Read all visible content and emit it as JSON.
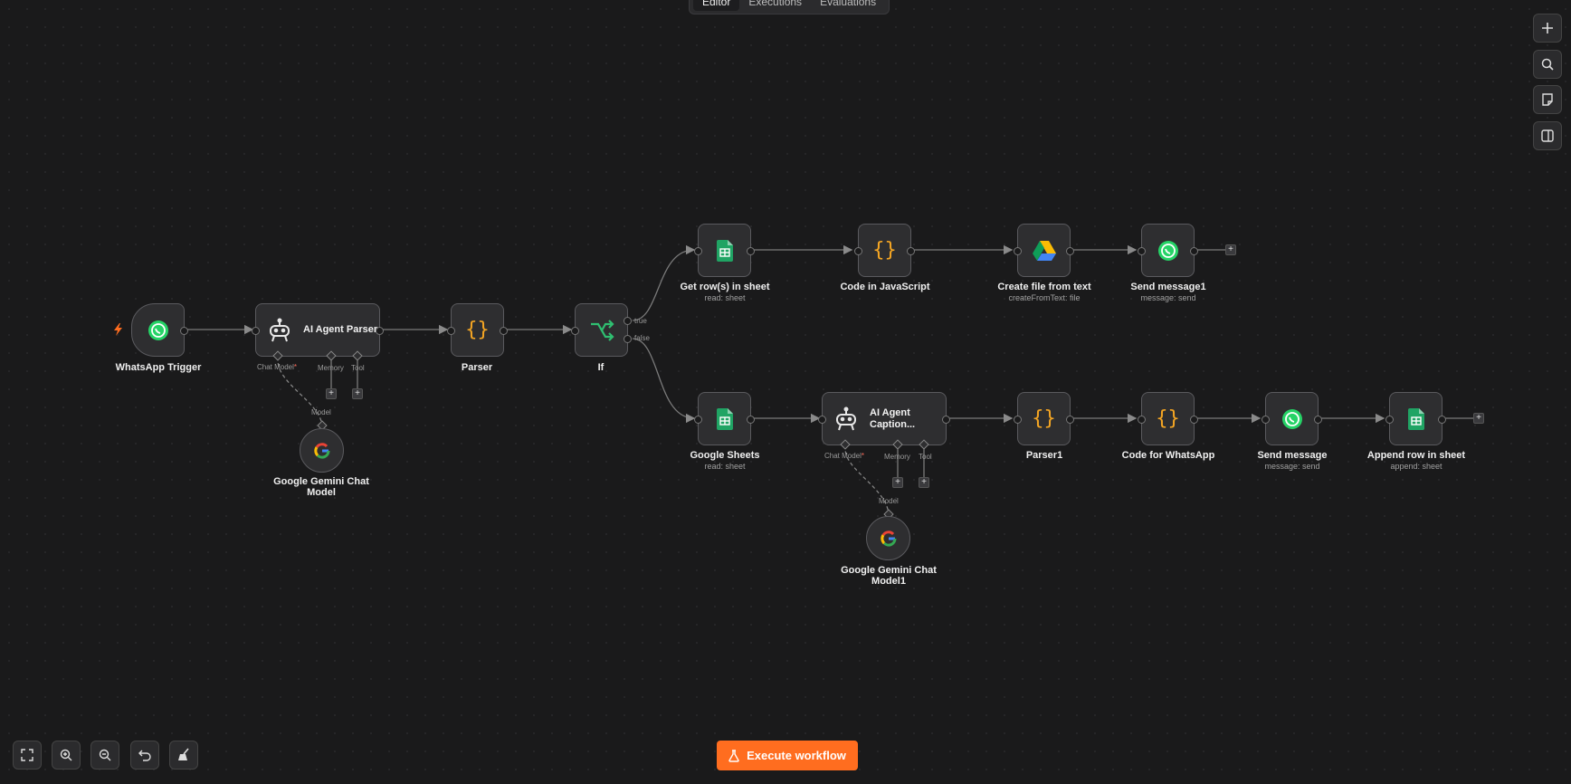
{
  "tabs": [
    "Editor",
    "Executions",
    "Evaluations"
  ],
  "nodes": {
    "whatsapp_trigger": {
      "label": "WhatsApp Trigger"
    },
    "ai_agent_parser": {
      "title": "AI Agent Parser",
      "ports": {
        "chat_model": "Chat Model",
        "memory": "Memory",
        "tool": "Tool"
      }
    },
    "gemini_1": {
      "label": "Google Gemini Chat Model",
      "port": "Model"
    },
    "parser": {
      "label": "Parser"
    },
    "if": {
      "label": "If",
      "true_label": "true",
      "false_label": "false"
    },
    "get_rows": {
      "label": "Get row(s) in sheet",
      "sub": "read: sheet"
    },
    "code_js": {
      "label": "Code in JavaScript"
    },
    "create_file": {
      "label": "Create file from text",
      "sub": "createFromText: file"
    },
    "send_message1": {
      "label": "Send message1",
      "sub": "message: send"
    },
    "google_sheets": {
      "label": "Google Sheets",
      "sub": "read: sheet"
    },
    "ai_agent_caption": {
      "title": "AI Agent Caption...",
      "ports": {
        "chat_model": "Chat Model",
        "memory": "Memory",
        "tool": "Tool"
      }
    },
    "gemini_2": {
      "label": "Google Gemini Chat Model1",
      "port": "Model"
    },
    "parser1": {
      "label": "Parser1"
    },
    "code_whatsapp": {
      "label": "Code for WhatsApp"
    },
    "send_message": {
      "label": "Send message",
      "sub": "message: send"
    },
    "append_row": {
      "label": "Append row in sheet",
      "sub": "append: sheet"
    }
  },
  "right_toolbar": [
    "plus-icon",
    "search-icon",
    "sticky-note-icon",
    "panel-icon"
  ],
  "bottom_toolbar": [
    "fit-view-icon",
    "zoom-in-icon",
    "zoom-out-icon",
    "undo-icon",
    "tidy-icon"
  ],
  "execute_button": "Execute workflow",
  "colors": {
    "accent": "#ff6d1f",
    "whatsapp": "#25d366",
    "sheets": "#20a464",
    "code": "#f5a623",
    "if": "#2fbf71"
  }
}
